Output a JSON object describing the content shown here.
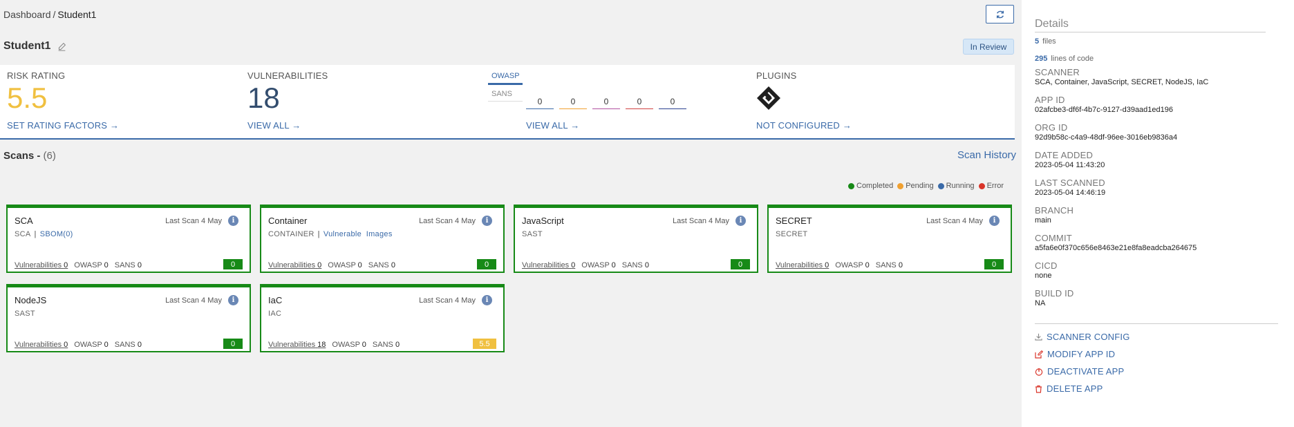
{
  "breadcrumb": {
    "root": "Dashboard",
    "separator": "/",
    "current": "Student1"
  },
  "app": {
    "name": "Student1",
    "status": "In Review"
  },
  "summary": {
    "risk": {
      "label": "RISK RATING",
      "value": "5.5",
      "link": "SET RATING FACTORS"
    },
    "vulnerabilities": {
      "label": "VULNERABILITIES",
      "value": "18",
      "link": "VIEW ALL"
    },
    "standards": {
      "tabs": [
        "OWASP",
        "SANS"
      ],
      "active_tab": "OWASP",
      "counters": [
        {
          "value": "0",
          "color": "#3a6aa8"
        },
        {
          "value": "0",
          "color": "#f0a030"
        },
        {
          "value": "0",
          "color": "#b050a0"
        },
        {
          "value": "0",
          "color": "#d04040"
        },
        {
          "value": "0",
          "color": "#2a3f8f"
        }
      ],
      "link": "VIEW ALL"
    },
    "plugins": {
      "label": "PLUGINS",
      "icon": "jira-logo",
      "link": "NOT CONFIGURED"
    }
  },
  "scans": {
    "title": "Scans - ",
    "count": "(6)",
    "history_link": "Scan History",
    "legend": [
      {
        "label": "Completed",
        "color": "#178a17"
      },
      {
        "label": "Pending",
        "color": "#f0a030"
      },
      {
        "label": "Running",
        "color": "#3a6aa8"
      },
      {
        "label": "Error",
        "color": "#d9352a"
      }
    ],
    "cards": [
      {
        "title": "SCA",
        "last": "Last Scan 4 May",
        "sub_plain": "SCA",
        "sub_link": "SBOM(0)",
        "vuln_label": "Vulnerabilities",
        "vulns": "0",
        "owasp_label": "OWASP",
        "owasp": "0",
        "sans_label": "SANS",
        "sans": "0",
        "score": "0",
        "score_color": "#178a17"
      },
      {
        "title": "Container",
        "last": "Last Scan 4 May",
        "sub_plain": "CONTAINER",
        "sub_link": "Vulnerable  Images",
        "vuln_label": "Vulnerabilities",
        "vulns": "0",
        "owasp_label": "OWASP",
        "owasp": "0",
        "sans_label": "SANS",
        "sans": "0",
        "score": "0",
        "score_color": "#178a17"
      },
      {
        "title": "JavaScript",
        "last": "Last Scan 4 May",
        "sub_plain": "SAST",
        "sub_link": "",
        "vuln_label": "Vulnerabilities",
        "vulns": "0",
        "owasp_label": "OWASP",
        "owasp": "0",
        "sans_label": "SANS",
        "sans": "0",
        "score": "0",
        "score_color": "#178a17"
      },
      {
        "title": "SECRET",
        "last": "Last Scan 4 May",
        "sub_plain": "SECRET",
        "sub_link": "",
        "vuln_label": "Vulnerabilities",
        "vulns": "0",
        "owasp_label": "OWASP",
        "owasp": "0",
        "sans_label": "SANS",
        "sans": "0",
        "score": "0",
        "score_color": "#178a17"
      },
      {
        "title": "NodeJS",
        "last": "Last Scan 4 May",
        "sub_plain": "SAST",
        "sub_link": "",
        "vuln_label": "Vulnerabilities",
        "vulns": "0",
        "owasp_label": "OWASP",
        "owasp": "0",
        "sans_label": "SANS",
        "sans": "0",
        "score": "0",
        "score_color": "#178a17"
      },
      {
        "title": "IaC",
        "last": "Last Scan 4 May",
        "sub_plain": "IAC",
        "sub_link": "",
        "vuln_label": "Vulnerabilities",
        "vulns": "18",
        "owasp_label": "OWASP",
        "owasp": "0",
        "sans_label": "SANS",
        "sans": "0",
        "score": "5.5",
        "score_color": "#f0c040"
      }
    ]
  },
  "details": {
    "title": "Details",
    "files_count": "5",
    "files_label": "files",
    "loc_count": "295",
    "loc_label": "lines of code",
    "fields": [
      {
        "label": "SCANNER",
        "value": "SCA, Container, JavaScript, SECRET, NodeJS, IaC"
      },
      {
        "label": "APP ID",
        "value": "02afcbe3-df6f-4b7c-9127-d39aad1ed196"
      },
      {
        "label": "ORG ID",
        "value": "92d9b58c-c4a9-48df-96ee-3016eb9836a4"
      },
      {
        "label": "DATE ADDED",
        "value": "2023-05-04 11:43:20"
      },
      {
        "label": "LAST SCANNED",
        "value": "2023-05-04 14:46:19"
      },
      {
        "label": "BRANCH",
        "value": "main"
      },
      {
        "label": "COMMIT",
        "value": "a5fa6e0f370c656e8463e21e8fa8eadcba264675"
      },
      {
        "label": "CICD",
        "value": "none"
      },
      {
        "label": "BUILD ID",
        "value": "NA"
      }
    ],
    "actions": [
      {
        "label": "SCANNER CONFIG",
        "icon": "download-icon",
        "color": "#888"
      },
      {
        "label": "MODIFY APP ID",
        "icon": "edit-icon",
        "color": "#d9352a"
      },
      {
        "label": "DEACTIVATE APP",
        "icon": "power-icon",
        "color": "#d9352a"
      },
      {
        "label": "DELETE APP",
        "icon": "trash-icon",
        "color": "#d9352a"
      }
    ]
  }
}
